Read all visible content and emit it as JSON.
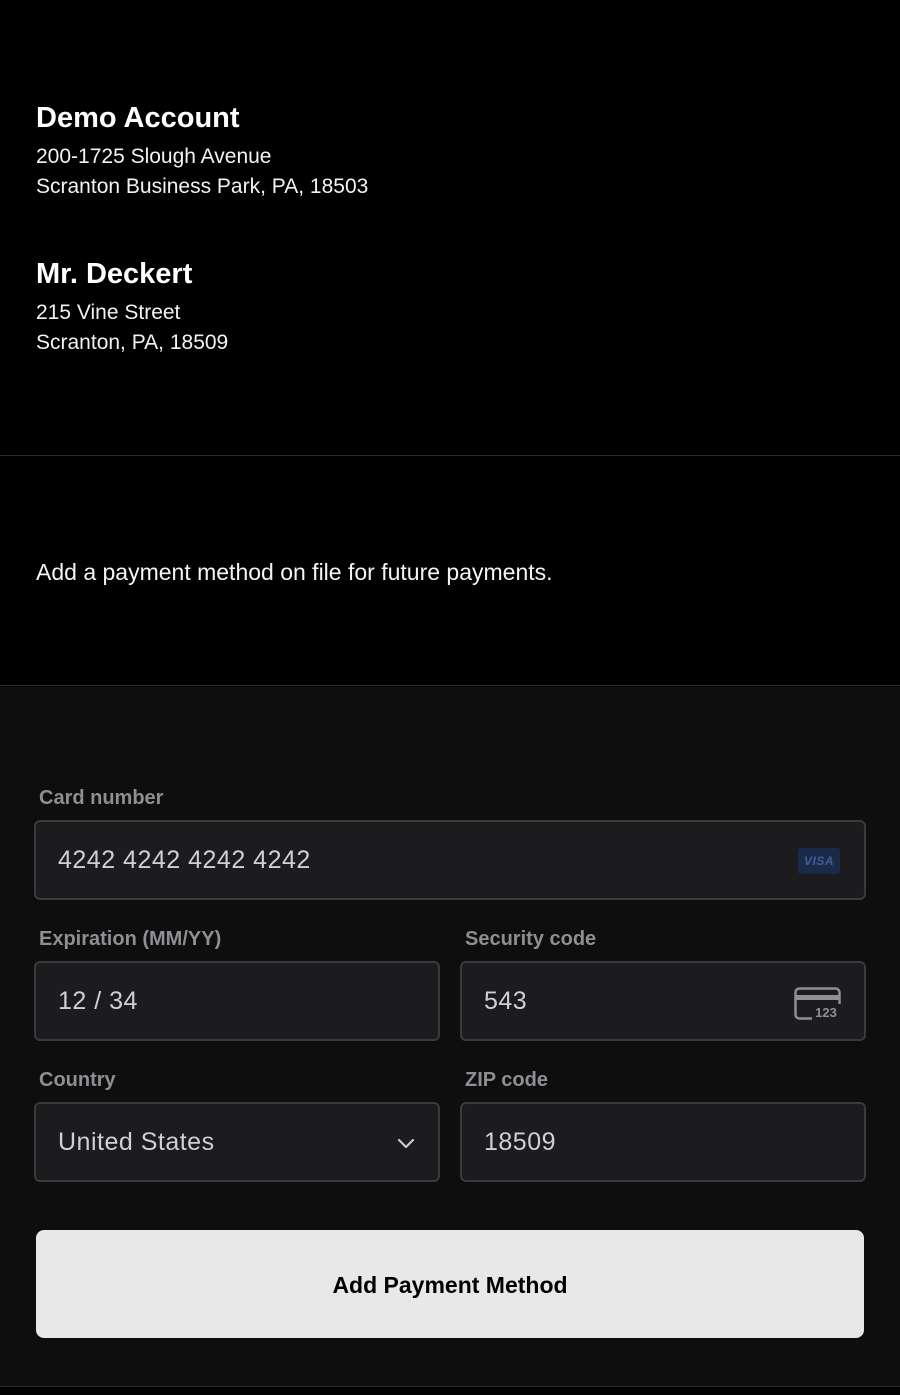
{
  "from": {
    "name": "Demo Account",
    "line1": "200-1725 Slough Avenue",
    "line2": "Scranton Business Park, PA, 18503"
  },
  "to": {
    "name": "Mr. Deckert",
    "line1": "215 Vine Street",
    "line2": "Scranton, PA, 18509"
  },
  "description": "Add a payment method on file for future payments.",
  "form": {
    "card_number": {
      "label": "Card number",
      "value": "4242 4242 4242 4242",
      "brand_badge": "VISA",
      "brand_icon": "visa-icon"
    },
    "expiration": {
      "label": "Expiration (MM/YY)",
      "value": "12 / 34"
    },
    "security_code": {
      "label": "Security code",
      "value": "543",
      "icon": "cvc-card-icon",
      "icon_text": "123"
    },
    "country": {
      "label": "Country",
      "value": "United States",
      "icon": "chevron-down-icon"
    },
    "zip": {
      "label": "ZIP code",
      "value": "18509"
    },
    "submit_label": "Add Payment Method"
  },
  "colors": {
    "background": "#000000",
    "form_background": "#0e0e0f",
    "field_background": "#1c1c1e",
    "field_border": "#3a3a3c",
    "label": "#8e8e93",
    "button_background": "#e8e8e8",
    "button_text": "#000000"
  }
}
